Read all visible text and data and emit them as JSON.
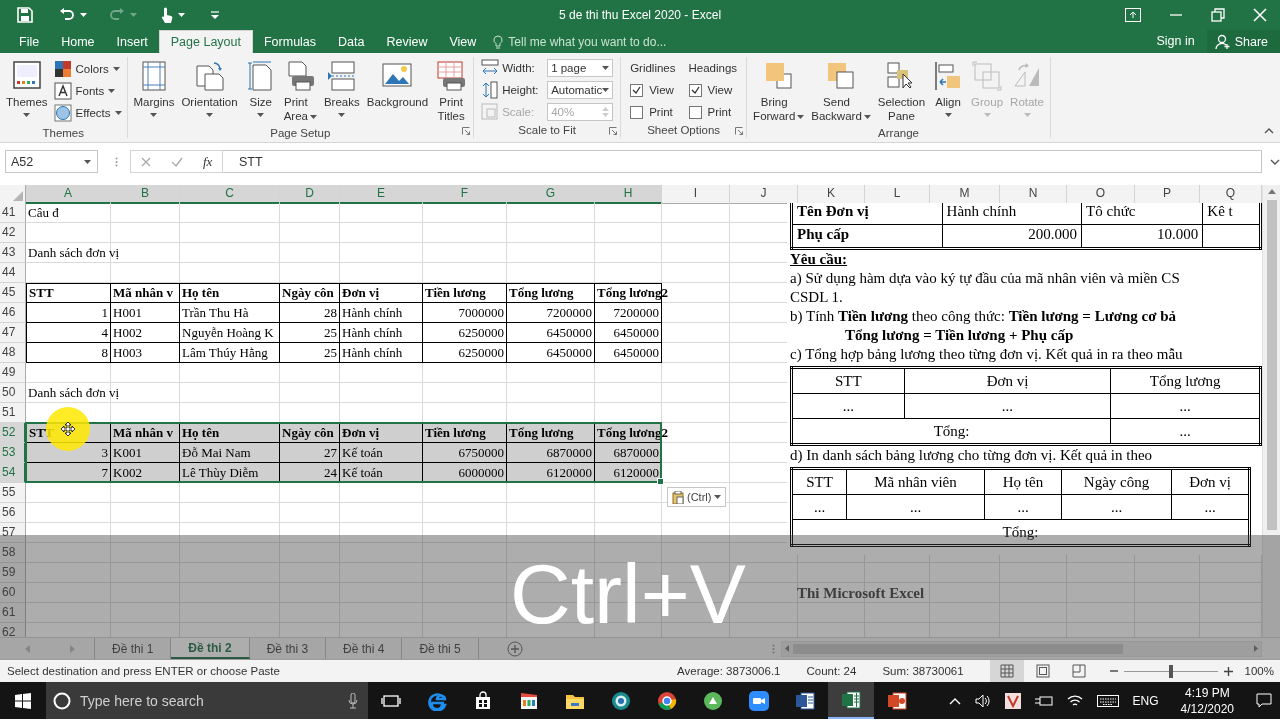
{
  "title_bar": {
    "title": "5 de thi thu Excel 2020 - Excel"
  },
  "ribbon": {
    "tabs": [
      {
        "label": "File",
        "selected": false
      },
      {
        "label": "Home",
        "selected": false
      },
      {
        "label": "Insert",
        "selected": false
      },
      {
        "label": "Page Layout",
        "selected": true
      },
      {
        "label": "Formulas",
        "selected": false
      },
      {
        "label": "Data",
        "selected": false
      },
      {
        "label": "Review",
        "selected": false
      },
      {
        "label": "View",
        "selected": false
      }
    ],
    "tell_me": "Tell me what you want to do...",
    "sign_in": "Sign in",
    "share": "Share",
    "groups": [
      {
        "name": "Themes",
        "launcher": false,
        "items": [
          {
            "kind": "large",
            "label": "Themes",
            "dropdown": true,
            "disabled": false
          },
          {
            "kind": "stack",
            "items": [
              {
                "label": "Colors"
              },
              {
                "label": "Fonts"
              },
              {
                "label": "Effects"
              }
            ]
          }
        ]
      },
      {
        "name": "Page Setup",
        "launcher": true,
        "items": [
          {
            "kind": "large",
            "label": "Margins",
            "dropdown": true,
            "disabled": false
          },
          {
            "kind": "large",
            "label": "Orientation",
            "dropdown": true,
            "disabled": false
          },
          {
            "kind": "large",
            "label": "Size",
            "dropdown": true,
            "disabled": false
          },
          {
            "kind": "large",
            "label": "Print Area",
            "dropdown": true,
            "disabled": false
          },
          {
            "kind": "large",
            "label": "Breaks",
            "dropdown": true,
            "disabled": false
          },
          {
            "kind": "large",
            "label": "Background",
            "dropdown": false,
            "disabled": false
          },
          {
            "kind": "large",
            "label": "Print Titles",
            "dropdown": false,
            "disabled": false
          }
        ]
      },
      {
        "name": "Scale to Fit",
        "launcher": true,
        "items": [
          {
            "kind": "fields",
            "items": [
              {
                "label": "Width:",
                "value": "1 page",
                "disabled": false
              },
              {
                "label": "Height:",
                "value": "Automatic",
                "disabled": false
              },
              {
                "label": "Scale:",
                "value": "40%",
                "disabled": true
              }
            ]
          }
        ]
      },
      {
        "name": "Sheet Options",
        "launcher": true,
        "items": [
          {
            "kind": "checks",
            "title": "Gridlines",
            "items": [
              {
                "label": "View",
                "checked": true
              },
              {
                "label": "Print",
                "checked": false
              }
            ]
          },
          {
            "kind": "checks",
            "title": "Headings",
            "items": [
              {
                "label": "View",
                "checked": true
              },
              {
                "label": "Print",
                "checked": false
              }
            ]
          }
        ]
      },
      {
        "name": "Arrange",
        "launcher": false,
        "items": [
          {
            "kind": "large",
            "label": "Bring Forward",
            "dropdown": true,
            "disabled": false
          },
          {
            "kind": "large",
            "label": "Send Backward",
            "dropdown": true,
            "disabled": false
          },
          {
            "kind": "large",
            "label": "Selection Pane",
            "dropdown": false,
            "disabled": false
          },
          {
            "kind": "large",
            "label": "Align",
            "dropdown": true,
            "disabled": false
          },
          {
            "kind": "large",
            "label": "Group",
            "dropdown": true,
            "disabled": true
          },
          {
            "kind": "large",
            "label": "Rotate",
            "dropdown": true,
            "disabled": true
          }
        ]
      }
    ]
  },
  "formula_bar": {
    "name_box": "A52",
    "function_label": "fx",
    "formula": "STT"
  },
  "sheet": {
    "columns": [
      {
        "label": "A",
        "selected": true
      },
      {
        "label": "B",
        "selected": true
      },
      {
        "label": "C",
        "selected": true
      },
      {
        "label": "D",
        "selected": true
      },
      {
        "label": "E",
        "selected": true
      },
      {
        "label": "F",
        "selected": true
      },
      {
        "label": "G",
        "selected": true
      },
      {
        "label": "H",
        "selected": true
      },
      {
        "label": "I",
        "selected": false
      },
      {
        "label": "J",
        "selected": false
      },
      {
        "label": "K",
        "selected": false
      },
      {
        "label": "L",
        "selected": false
      },
      {
        "label": "M",
        "selected": false
      },
      {
        "label": "N",
        "selected": false
      },
      {
        "label": "O",
        "selected": false
      },
      {
        "label": "P",
        "selected": false
      },
      {
        "label": "Q",
        "selected": false
      }
    ],
    "rows": [
      {
        "label": "41",
        "kind": "note",
        "selected": false,
        "cells": [
          "Câu đ"
        ]
      },
      {
        "label": "42",
        "kind": "empty",
        "selected": false
      },
      {
        "label": "43",
        "kind": "note",
        "selected": false,
        "cells": [
          "Danh sách đơn vị"
        ]
      },
      {
        "label": "44",
        "kind": "empty",
        "selected": false
      },
      {
        "label": "45",
        "kind": "header",
        "selected": false,
        "cells": [
          "STT",
          "Mã nhân v",
          "Họ tên",
          "Ngày côn",
          "Đơn vị",
          "Tiền lương",
          "Tổng lương",
          "Tổng lương2"
        ]
      },
      {
        "label": "46",
        "kind": "data",
        "selected": false,
        "cells": [
          "1",
          "H001",
          "Trần Thu Hà",
          "28",
          "Hành chính",
          "7000000",
          "7200000",
          "7200000"
        ]
      },
      {
        "label": "47",
        "kind": "data",
        "selected": false,
        "cells": [
          "4",
          "H002",
          "Nguyễn Hoàng K",
          "25",
          "Hành chính",
          "6250000",
          "6450000",
          "6450000"
        ]
      },
      {
        "label": "48",
        "kind": "data",
        "selected": false,
        "cells": [
          "8",
          "H003",
          "Lâm Thúy Hằng",
          "25",
          "Hành chính",
          "6250000",
          "6450000",
          "6450000"
        ]
      },
      {
        "label": "49",
        "kind": "empty",
        "selected": false
      },
      {
        "label": "50",
        "kind": "note",
        "selected": false,
        "cells": [
          "Danh sách đơn vị"
        ]
      },
      {
        "label": "51",
        "kind": "empty",
        "selected": false
      },
      {
        "label": "52",
        "kind": "header",
        "selected": true,
        "cells": [
          "STT",
          "Mã nhân v",
          "Họ tên",
          "Ngày côn",
          "Đơn vị",
          "Tiền lương",
          "Tổng lương",
          "Tổng lương2"
        ]
      },
      {
        "label": "53",
        "kind": "data",
        "selected": true,
        "cells": [
          "3",
          "K001",
          "Đỗ Mai Nam",
          "27",
          "Kế toán",
          "6750000",
          "6870000",
          "6870000"
        ]
      },
      {
        "label": "54",
        "kind": "data",
        "selected": true,
        "cells": [
          "7",
          "K002",
          "Lê Thùy Diễm",
          "24",
          "Kế toán",
          "6000000",
          "6120000",
          "6120000"
        ]
      },
      {
        "label": "55",
        "kind": "empty",
        "selected": false
      },
      {
        "label": "56",
        "kind": "empty",
        "selected": false
      },
      {
        "label": "57",
        "kind": "empty",
        "selected": false
      },
      {
        "label": "58",
        "kind": "empty",
        "selected": false
      },
      {
        "label": "59",
        "kind": "empty",
        "selected": false
      },
      {
        "label": "60",
        "kind": "empty",
        "selected": false
      },
      {
        "label": "61",
        "kind": "empty",
        "selected": false
      },
      {
        "label": "62",
        "kind": "empty",
        "selected": false
      }
    ],
    "paste_options": "(Ctrl)",
    "embedded_document": {
      "blocks": [
        {
          "kind": "lookup_table",
          "rows": [
            [
              "Tên Đơn vị",
              "Hành chính",
              "Tô chức",
              "Kê t"
            ],
            [
              "Phụ cấp",
              "200.000",
              "10.000"
            ]
          ]
        },
        {
          "kind": "heading",
          "text": "Yêu cầu:"
        },
        {
          "kind": "text",
          "text": "a) Sử dụng hàm dựa vào ký tự đầu của mã nhân viên và miền CS"
        },
        {
          "kind": "text",
          "text": "CSDL 1."
        },
        {
          "kind": "text",
          "text": "b) Tính **Tiền lương** theo công thức: **Tiền lương = Lương cơ bả**"
        },
        {
          "kind": "formula",
          "text": "Tổng lương = Tiền lương + Phụ cấp"
        },
        {
          "kind": "text",
          "text": "c) Tổng hợp bảng lương theo từng đơn vị. Kết quả in ra theo mẫu"
        },
        {
          "kind": "form_table",
          "rows": [
            [
              "STT",
              "Đơn vị",
              "Tổng lương"
            ],
            [
              "...",
              "...",
              "..."
            ],
            [
              {
                "text": "Tổng:",
                "colspan": 2
              },
              "..."
            ]
          ]
        },
        {
          "kind": "text",
          "text": "d) In danh sách bảng lương cho từng đơn vị. Kết quả in theo"
        },
        {
          "kind": "form_table",
          "rows": [
            [
              "STT",
              "Mã nhân viên",
              "Họ tên",
              "Ngày công",
              "Đơn vị"
            ],
            [
              "...",
              "...",
              "...",
              "...",
              "..."
            ],
            [
              {
                "text": "Tổng:",
                "colspan": 5
              }
            ]
          ]
        }
      ]
    }
  },
  "sheet_tabs": [
    {
      "label": "Đề thi 1",
      "selected": false
    },
    {
      "label": "Đề thi 2",
      "selected": true
    },
    {
      "label": "Đề thi 3",
      "selected": false
    },
    {
      "label": "Đề thi 4",
      "selected": false
    },
    {
      "label": "Đề thi 5",
      "selected": false
    }
  ],
  "status_bar": {
    "message": "Select destination and press ENTER or choose Paste",
    "average": "Average: 3873006.1",
    "count": "Count: 24",
    "sum": "Sum: 38730061",
    "views": [
      {
        "kind": "normal",
        "selected": true
      },
      {
        "kind": "page_layout",
        "selected": false
      },
      {
        "kind": "page_break",
        "selected": false
      }
    ],
    "zoom": {
      "level": 0.5,
      "reading": "100%"
    }
  },
  "taskbar": {
    "search_placeholder": "Type here to search",
    "apps": [
      {
        "kind": "task_view",
        "selected": false
      },
      {
        "kind": "browser_e",
        "selected": false
      },
      {
        "kind": "store",
        "selected": false
      },
      {
        "kind": "media",
        "selected": false
      },
      {
        "kind": "folder",
        "selected": false
      },
      {
        "kind": "globe",
        "selected": false
      },
      {
        "kind": "browser_ring",
        "selected": false
      },
      {
        "kind": "green_app",
        "selected": false
      },
      {
        "kind": "camera",
        "selected": false
      },
      {
        "kind": "doc_blue",
        "selected": false
      },
      {
        "kind": "doc_green",
        "selected": true
      },
      {
        "kind": "doc_orange",
        "selected": false
      }
    ],
    "language": "ENG",
    "time": "4:19 PM",
    "date": "4/12/2020"
  },
  "overlay": {
    "shortcut": "Ctrl+V",
    "caption": "Thi Microsoft Excel"
  }
}
